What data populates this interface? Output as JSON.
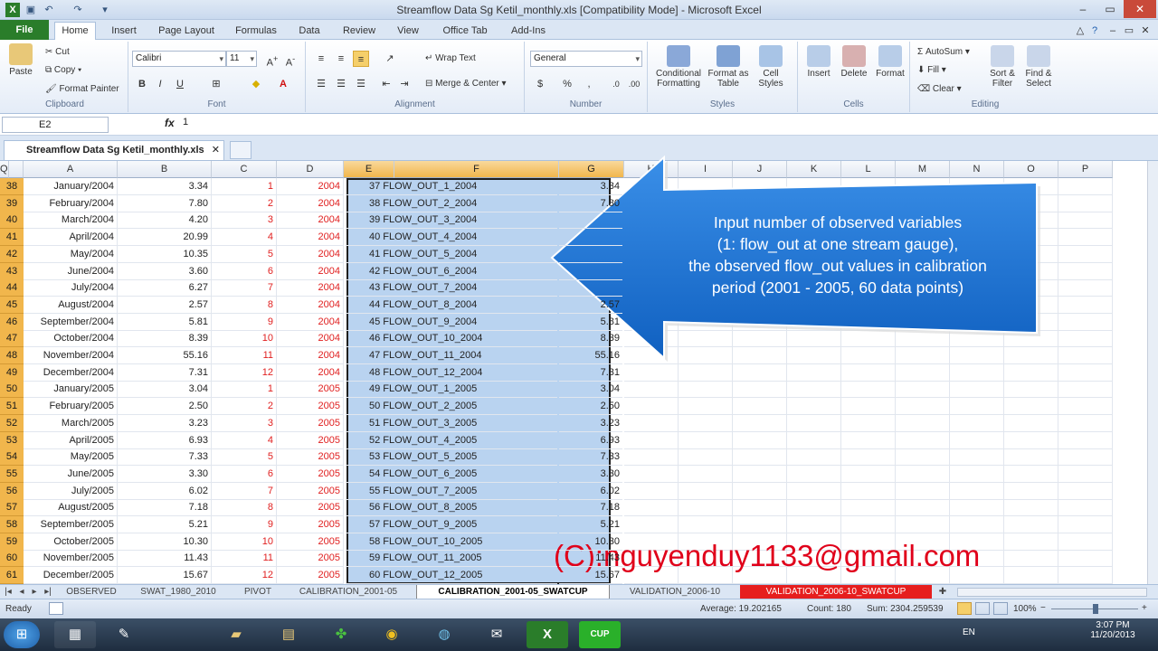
{
  "window": {
    "title": "Streamflow Data Sg Ketil_monthly.xls  [Compatibility Mode]  -  Microsoft Excel"
  },
  "menu": {
    "tabs": [
      "File",
      "Home",
      "Insert",
      "Page Layout",
      "Formulas",
      "Data",
      "Review",
      "View",
      "Office Tab",
      "Add-Ins"
    ]
  },
  "ribbon": {
    "clipboard": {
      "paste": "Paste",
      "cut": "Cut",
      "copy": "Copy",
      "format_painter": "Format Painter",
      "label": "Clipboard"
    },
    "font": {
      "name": "Calibri",
      "size": "11",
      "label": "Font"
    },
    "alignment": {
      "wrap": "Wrap Text",
      "merge": "Merge & Center",
      "label": "Alignment"
    },
    "number": {
      "format": "General",
      "label": "Number"
    },
    "styles": {
      "cond": "Conditional Formatting",
      "table": "Format as Table",
      "cell": "Cell Styles",
      "label": "Styles"
    },
    "cells": {
      "insert": "Insert",
      "delete": "Delete",
      "format": "Format",
      "label": "Cells"
    },
    "editing": {
      "autosum": "AutoSum",
      "fill": "Fill",
      "clear": "Clear",
      "sort": "Sort & Filter",
      "find": "Find & Select",
      "label": "Editing"
    }
  },
  "formula_bar": {
    "cell": "E2",
    "fx": "fx",
    "value": "1"
  },
  "workbook_tab": "Streamflow Data Sg Ketil_monthly.xls",
  "columns": [
    "A",
    "B",
    "C",
    "D",
    "E",
    "F",
    "G",
    "H",
    "I",
    "J",
    "K",
    "L",
    "M",
    "N",
    "O",
    "P",
    "Q"
  ],
  "rows": [
    {
      "n": "38",
      "a": "January/2004",
      "b": "3.34",
      "c": "1",
      "d": "2004",
      "e": "37 FLOW_OUT_1_2004",
      "g": "3.34"
    },
    {
      "n": "39",
      "a": "February/2004",
      "b": "7.80",
      "c": "2",
      "d": "2004",
      "e": "38 FLOW_OUT_2_2004",
      "g": "7.80"
    },
    {
      "n": "40",
      "a": "March/2004",
      "b": "4.20",
      "c": "3",
      "d": "2004",
      "e": "39 FLOW_OUT_3_2004",
      "g": ""
    },
    {
      "n": "41",
      "a": "April/2004",
      "b": "20.99",
      "c": "4",
      "d": "2004",
      "e": "40 FLOW_OUT_4_2004",
      "g": ""
    },
    {
      "n": "42",
      "a": "May/2004",
      "b": "10.35",
      "c": "5",
      "d": "2004",
      "e": "41 FLOW_OUT_5_2004",
      "g": ""
    },
    {
      "n": "43",
      "a": "June/2004",
      "b": "3.60",
      "c": "6",
      "d": "2004",
      "e": "42 FLOW_OUT_6_2004",
      "g": ""
    },
    {
      "n": "44",
      "a": "July/2004",
      "b": "6.27",
      "c": "7",
      "d": "2004",
      "e": "43 FLOW_OUT_7_2004",
      "g": ""
    },
    {
      "n": "45",
      "a": "August/2004",
      "b": "2.57",
      "c": "8",
      "d": "2004",
      "e": "44 FLOW_OUT_8_2004",
      "g": "2.57"
    },
    {
      "n": "46",
      "a": "September/2004",
      "b": "5.81",
      "c": "9",
      "d": "2004",
      "e": "45 FLOW_OUT_9_2004",
      "g": "5.81"
    },
    {
      "n": "47",
      "a": "October/2004",
      "b": "8.39",
      "c": "10",
      "d": "2004",
      "e": "46 FLOW_OUT_10_2004",
      "g": "8.39"
    },
    {
      "n": "48",
      "a": "November/2004",
      "b": "55.16",
      "c": "11",
      "d": "2004",
      "e": "47 FLOW_OUT_11_2004",
      "g": "55.16"
    },
    {
      "n": "49",
      "a": "December/2004",
      "b": "7.31",
      "c": "12",
      "d": "2004",
      "e": "48 FLOW_OUT_12_2004",
      "g": "7.31"
    },
    {
      "n": "50",
      "a": "January/2005",
      "b": "3.04",
      "c": "1",
      "d": "2005",
      "e": "49 FLOW_OUT_1_2005",
      "g": "3.04"
    },
    {
      "n": "51",
      "a": "February/2005",
      "b": "2.50",
      "c": "2",
      "d": "2005",
      "e": "50 FLOW_OUT_2_2005",
      "g": "2.50"
    },
    {
      "n": "52",
      "a": "March/2005",
      "b": "3.23",
      "c": "3",
      "d": "2005",
      "e": "51 FLOW_OUT_3_2005",
      "g": "3.23"
    },
    {
      "n": "53",
      "a": "April/2005",
      "b": "6.93",
      "c": "4",
      "d": "2005",
      "e": "52 FLOW_OUT_4_2005",
      "g": "6.93"
    },
    {
      "n": "54",
      "a": "May/2005",
      "b": "7.33",
      "c": "5",
      "d": "2005",
      "e": "53 FLOW_OUT_5_2005",
      "g": "7.33"
    },
    {
      "n": "55",
      "a": "June/2005",
      "b": "3.30",
      "c": "6",
      "d": "2005",
      "e": "54 FLOW_OUT_6_2005",
      "g": "3.30"
    },
    {
      "n": "56",
      "a": "July/2005",
      "b": "6.02",
      "c": "7",
      "d": "2005",
      "e": "55 FLOW_OUT_7_2005",
      "g": "6.02"
    },
    {
      "n": "57",
      "a": "August/2005",
      "b": "7.18",
      "c": "8",
      "d": "2005",
      "e": "56 FLOW_OUT_8_2005",
      "g": "7.18"
    },
    {
      "n": "58",
      "a": "September/2005",
      "b": "5.21",
      "c": "9",
      "d": "2005",
      "e": "57 FLOW_OUT_9_2005",
      "g": "5.21"
    },
    {
      "n": "59",
      "a": "October/2005",
      "b": "10.30",
      "c": "10",
      "d": "2005",
      "e": "58 FLOW_OUT_10_2005",
      "g": "10.30"
    },
    {
      "n": "60",
      "a": "November/2005",
      "b": "11.43",
      "c": "11",
      "d": "2005",
      "e": "59 FLOW_OUT_11_2005",
      "g": "11.43"
    },
    {
      "n": "61",
      "a": "December/2005",
      "b": "15.67",
      "c": "12",
      "d": "2005",
      "e": "60 FLOW_OUT_12_2005",
      "g": "15.67"
    }
  ],
  "callout": {
    "lines": [
      "Input number of observed variables",
      "(1: flow_out at one stream gauge),",
      "the observed flow_out values in calibration",
      "period (2001 - 2005, 60 data points)"
    ]
  },
  "watermark": "(C):nguyenduy1133@gmail.com",
  "sheets": [
    "OBSERVED",
    "SWAT_1980_2010",
    "PIVOT",
    "CALIBRATION_2001-05",
    "CALIBRATION_2001-05_SWATCUP",
    "VALIDATION_2006-10",
    "VALIDATION_2006-10_SWATCUP"
  ],
  "status": {
    "ready": "Ready",
    "average": "Average: 19.202165",
    "count": "Count: 180",
    "sum": "Sum: 2304.259539",
    "zoom": "100%"
  },
  "taskbar": {
    "lang": "EN",
    "time": "3:07 PM",
    "date": "11/20/2013",
    "cup": "CUP"
  }
}
